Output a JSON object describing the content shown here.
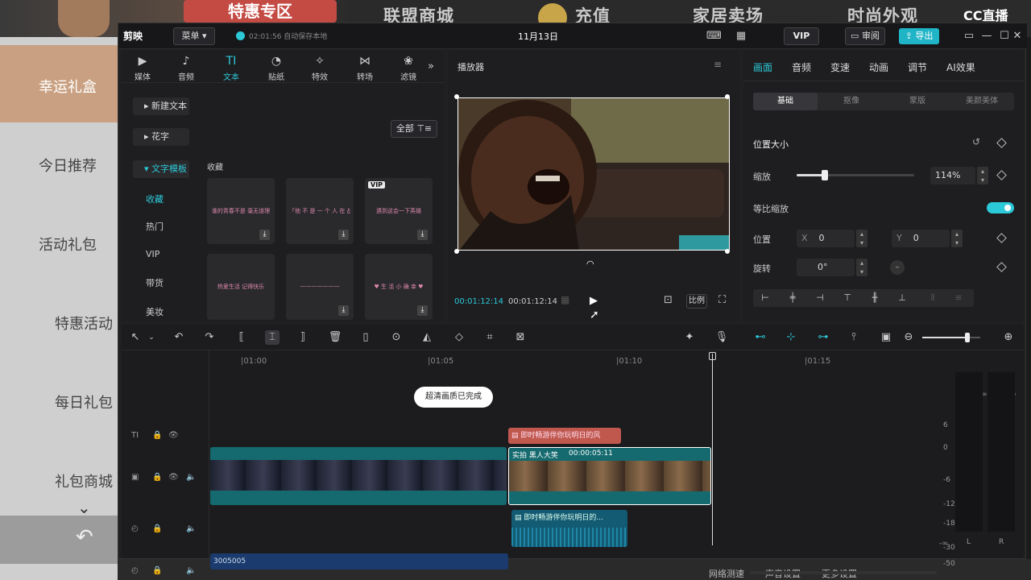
{
  "background": {
    "nav_items": [
      "联盟商城",
      "充值",
      "家居卖场",
      "时尚外观"
    ],
    "banner_text": "特惠专区",
    "left_items": [
      "幸运礼盒",
      "今日推荐",
      "活动礼包",
      "特惠活动",
      "每日礼包",
      "礼包商城"
    ],
    "bottom_items": [
      "网络测速",
      "声音设置",
      "更多设置"
    ],
    "stream_logo": "CC直播"
  },
  "app": {
    "logo": "剪映",
    "menu_label": "菜单",
    "autosave": "02:01:56 自动保存本地",
    "project_title": "11月13日",
    "vip_label": "VIP",
    "review_label": "审阅",
    "export_label": "导出"
  },
  "library": {
    "tabs": [
      {
        "icon": "▶",
        "label": "媒体"
      },
      {
        "icon": "♪",
        "label": "音频"
      },
      {
        "icon": "TI",
        "label": "文本"
      },
      {
        "icon": "◔",
        "label": "贴纸"
      },
      {
        "icon": "✧",
        "label": "特效"
      },
      {
        "icon": "⋈",
        "label": "转场"
      },
      {
        "icon": "❀",
        "label": "滤镜"
      }
    ],
    "more": "»",
    "side_items": [
      "新建文本",
      "花字",
      "文字模板"
    ],
    "sub_items": [
      "收藏",
      "热门",
      "VIP",
      "带货",
      "美妆"
    ],
    "filter_label": "全部",
    "section_title": "收藏",
    "cards": [
      {
        "text": "谁的青春不是 毫无道理"
      },
      {
        "text": "「他 不 是 一 个 人 在 战 斗」"
      },
      {
        "text": "遇到这会一下英雄",
        "vip": "VIP"
      },
      {
        "text": "热爱生活 记得快乐"
      },
      {
        "text": "———————"
      },
      {
        "text": "♥ 生 活 小 确 幸 ♥"
      }
    ]
  },
  "player": {
    "title": "播放器",
    "time_current": "00:01:12:14",
    "time_total": "00:01:12:14",
    "ratio_label": "比例"
  },
  "inspector": {
    "tabs": [
      "画面",
      "音频",
      "变速",
      "动画",
      "调节",
      "AI效果"
    ],
    "subtabs": [
      "基础",
      "抠像",
      "蒙版",
      "美颜美体"
    ],
    "section": "位置大小",
    "scale_label": "缩放",
    "scale_value": "114%",
    "scale_fraction": 0.24,
    "uniform_label": "等比缩放",
    "position_label": "位置",
    "pos_x_label": "X",
    "pos_x": "0",
    "pos_y_label": "Y",
    "pos_y": "0",
    "rotate_label": "旋转",
    "rotate_value": "0°"
  },
  "timeline": {
    "ruler": [
      "|01:00",
      "|01:05",
      "|01:10",
      "|01:15"
    ],
    "text_clip": "即时畅游伴你玩明日的风",
    "video_clip_name": "实拍 黑人大笑",
    "video_clip_duration": "00:00:05:11",
    "audio_clip": "即时畅游伴你玩明日的...",
    "blue_clip": "3005005",
    "toast": "超清画质已完成",
    "zoom_fraction": 0.78
  },
  "meter": {
    "labels": [
      "6",
      "0",
      "-6",
      "-12",
      "-18",
      "-30",
      "-50",
      "-∞"
    ],
    "channel_top": "-∞",
    "left": "L",
    "right": "R"
  },
  "colors": {
    "accent": "#2cc9d8",
    "export": "#1fb4c6",
    "video_track": "#146a6e",
    "audio_track": "#135a73",
    "text_clip": "#c0584e",
    "blue_clip": "#1b3b6e"
  }
}
